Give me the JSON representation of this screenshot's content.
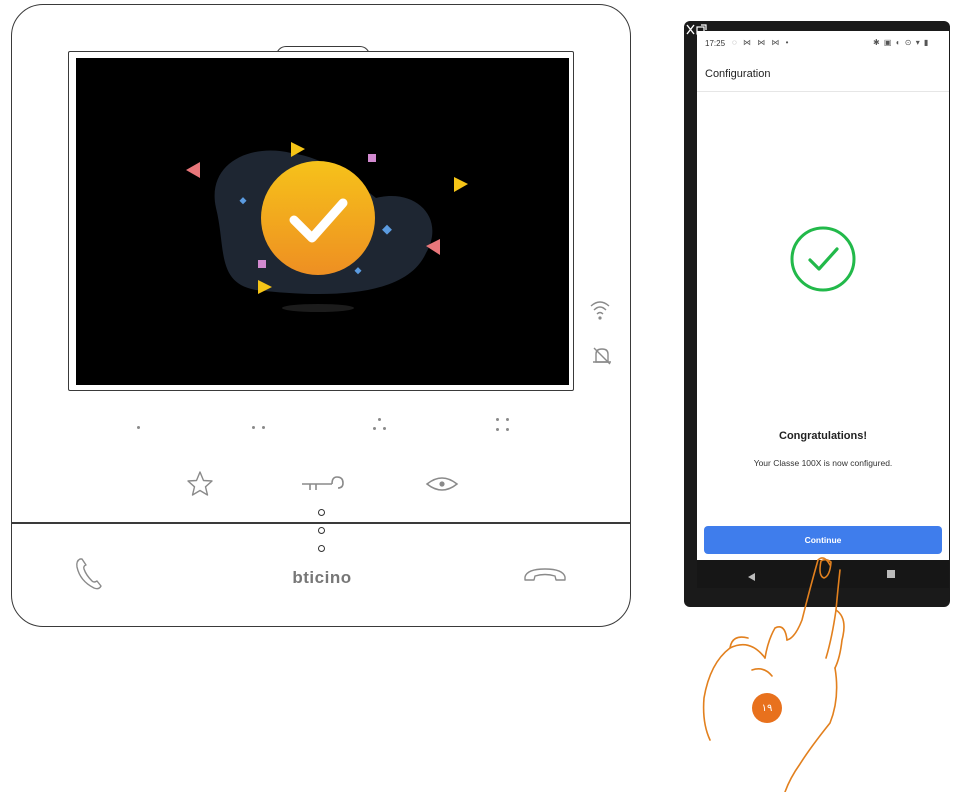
{
  "device": {
    "brand": "bticino",
    "screen_icon": "success-check-icon",
    "status_icons": [
      "wifi-icon",
      "bell-off-icon"
    ],
    "keys": [
      "favourite-star-icon",
      "door-key-icon",
      "eye-icon"
    ],
    "bottom_icons": [
      "answer-handset-icon",
      "hangup-handset-icon"
    ]
  },
  "phone": {
    "statusbar": {
      "time": "17:25",
      "right_icons": "✱ ▣ ◐ ⊙ ▾ ▮"
    },
    "title": "Configuration",
    "heading": "Congratulations!",
    "message": "Your Classe 100X is now configured.",
    "button_label": "Continue"
  },
  "annotation": {
    "step_number": "١٩"
  },
  "colors": {
    "success_green": "#22b94a",
    "button_blue": "#3f7dec",
    "badge_orange": "#e8711d",
    "hand_orange": "#e2801e"
  }
}
